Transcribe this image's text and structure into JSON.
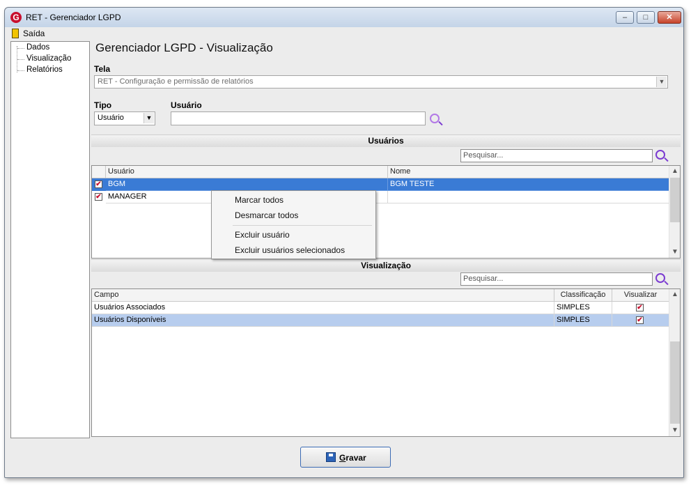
{
  "window": {
    "title": "RET - Gerenciador LGPD",
    "icon": "ret-logo-icon"
  },
  "menu": {
    "exit": "Saída"
  },
  "tree": {
    "items": [
      "Dados",
      "Visualização",
      "Relatórios"
    ]
  },
  "page": {
    "title": "Gerenciador LGPD - Visualização"
  },
  "tela": {
    "label": "Tela",
    "value": "RET - Configuração e permissão de relatórios"
  },
  "tipo": {
    "label": "Tipo",
    "value": "Usuário"
  },
  "usuario": {
    "label": "Usuário",
    "value": ""
  },
  "users_section": {
    "title": "Usuários",
    "search_placeholder": "Pesquisar...",
    "columns": [
      "Usuário",
      "Nome"
    ],
    "rows": [
      {
        "checked": true,
        "user": "BGM",
        "name": "BGM TESTE",
        "selected": true
      },
      {
        "checked": true,
        "user": "MANAGER",
        "name": "",
        "selected": false
      }
    ]
  },
  "context_menu": {
    "items": [
      "Marcar todos",
      "Desmarcar todos",
      "Excluir usuário",
      "Excluir usuários selecionados"
    ]
  },
  "view_section": {
    "title": "Visualização",
    "search_placeholder": "Pesquisar...",
    "columns": [
      "Campo",
      "Classificação",
      "Visualizar"
    ],
    "rows": [
      {
        "campo": "Usuários Associados",
        "classificacao": "SIMPLES",
        "visualizar": true,
        "selected": false
      },
      {
        "campo": "Usuários Disponíveis",
        "classificacao": "SIMPLES",
        "visualizar": true,
        "selected": true
      }
    ]
  },
  "save_button": {
    "label_underlined": "G",
    "label_rest": "ravar"
  },
  "colors": {
    "selection": "#3a7bd5",
    "selection_light": "#b7cdee",
    "accent": "#7b3bd1",
    "brand": "#c8102e"
  }
}
